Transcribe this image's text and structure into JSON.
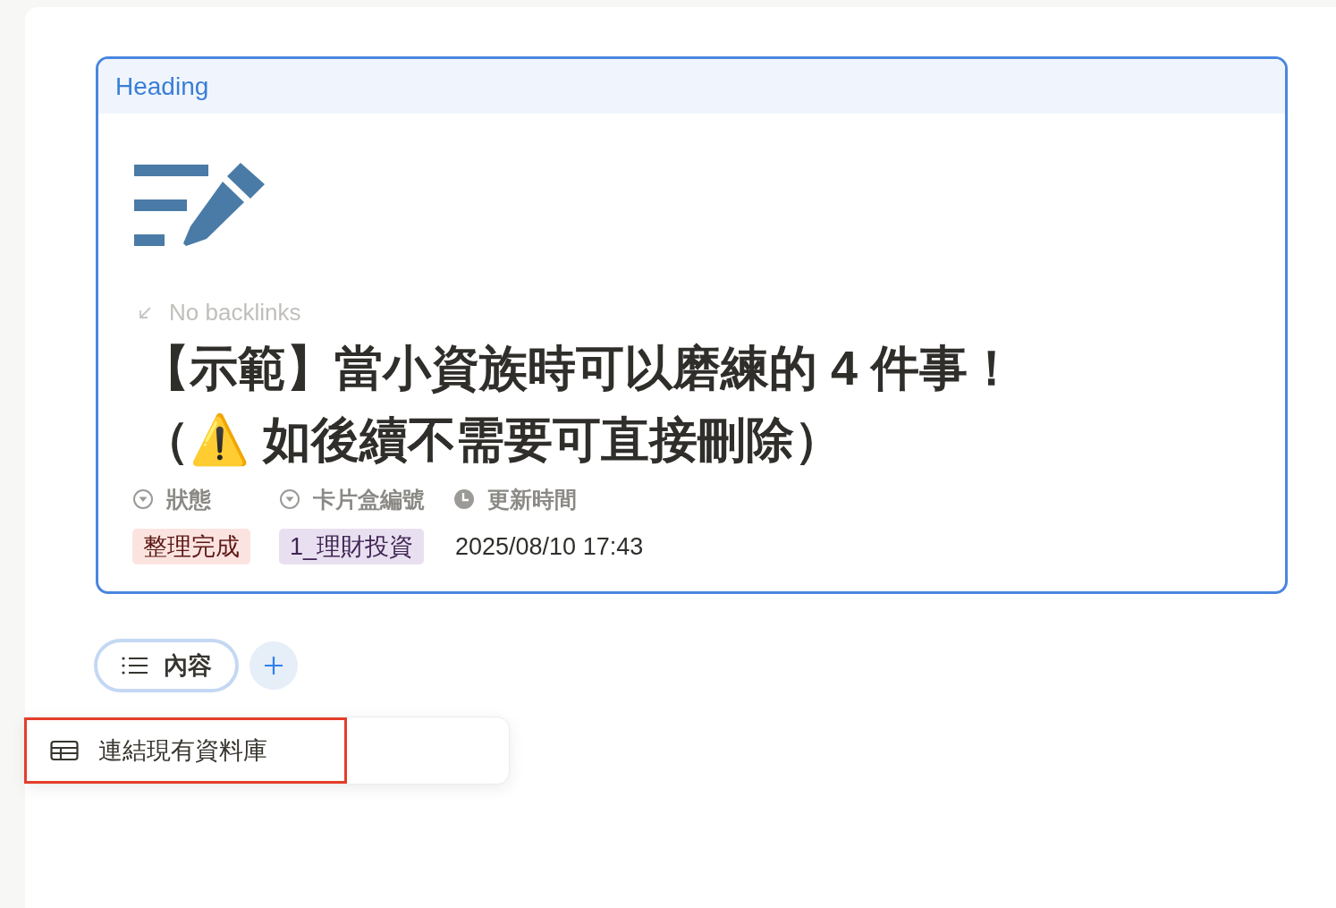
{
  "block": {
    "header": "Heading",
    "backlinks": "No backlinks",
    "title": "【示範】當小資族時可以磨練的 4 件事！（⚠️ 如後續不需要可直接刪除）",
    "properties": [
      {
        "kind": "select",
        "label": "狀態",
        "value": "整理完成",
        "color": "#fbe4e0"
      },
      {
        "kind": "select",
        "label": "卡片盒編號",
        "value": "1_理財投資",
        "color": "#e8e0f0"
      },
      {
        "kind": "time",
        "label": "更新時間",
        "value": "2025/08/10 17:43"
      }
    ]
  },
  "tabs": [
    {
      "label": "內容",
      "selected": true
    }
  ],
  "menu": {
    "items": [
      {
        "label": "連結現有資料庫",
        "selected": true
      }
    ]
  }
}
